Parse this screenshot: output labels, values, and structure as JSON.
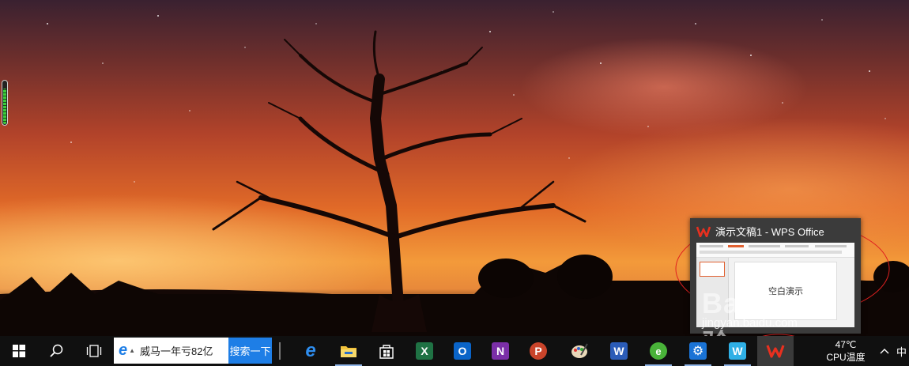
{
  "taskbar": {
    "search": {
      "text": "威马一年亏82亿",
      "button": "搜索一下"
    },
    "apps": [
      {
        "name": "edge",
        "glyph": "e",
        "color": "#1a73d6"
      },
      {
        "name": "file-explorer",
        "glyph": "▬",
        "color": "#f1c232"
      },
      {
        "name": "store",
        "glyph": "⊞",
        "color": "#ffffff"
      },
      {
        "name": "excel",
        "glyph": "X",
        "color": "#1f7244"
      },
      {
        "name": "outlook",
        "glyph": "O",
        "color": "#0a64c8"
      },
      {
        "name": "onenote",
        "glyph": "N",
        "color": "#7b2fa8"
      },
      {
        "name": "powerpoint",
        "glyph": "P",
        "color": "#c9442a"
      },
      {
        "name": "paint",
        "glyph": "✎",
        "color": "#3d7bd1"
      },
      {
        "name": "word",
        "glyph": "W",
        "color": "#2b5cb8"
      },
      {
        "name": "browser",
        "glyph": "e",
        "color": "#49b339"
      },
      {
        "name": "settings",
        "glyph": "⚙",
        "color": "#1a73d6"
      },
      {
        "name": "wps-writer",
        "glyph": "W",
        "color": "#2fb0e6"
      },
      {
        "name": "wps-office",
        "glyph": "W",
        "color": "#e02c20"
      }
    ],
    "tray": {
      "temperature": "47℃",
      "temp_label": "CPU温度",
      "ime": "中"
    }
  },
  "preview": {
    "title": "演示文稿1 - WPS Office",
    "slide_text": "空白演示"
  },
  "watermark": {
    "main": "Bai du 经验",
    "sub": "jingyan.baidu.com"
  },
  "volume": {
    "level": 0.8
  }
}
